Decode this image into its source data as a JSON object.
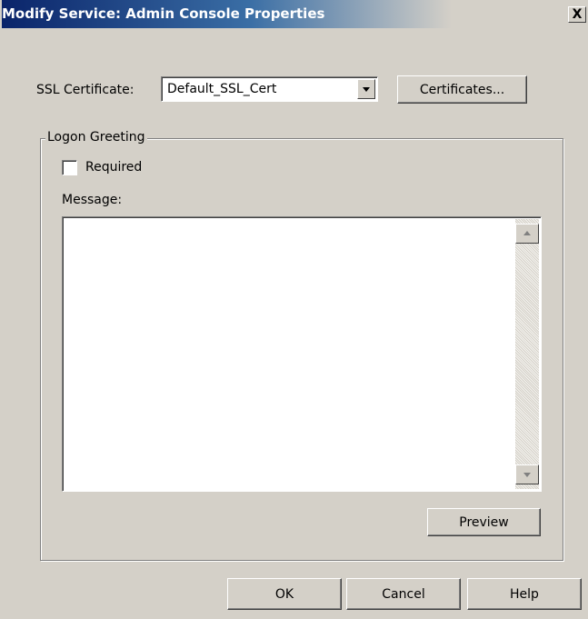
{
  "window": {
    "title": "Modify Service: Admin Console Properties",
    "close_glyph": "X"
  },
  "ssl": {
    "label": "SSL Certificate:",
    "selected_value": "Default_SSL_Cert",
    "certificates_button": "Certificates..."
  },
  "logon_greeting": {
    "group_label": "Logon Greeting",
    "required_label": "Required",
    "required_checked": false,
    "message_label": "Message:",
    "message_value": "",
    "preview_button": "Preview"
  },
  "footer": {
    "ok_button": "OK",
    "cancel_button": "Cancel",
    "help_button": "Help"
  },
  "colors": {
    "title_gradient_start": "#0a246a",
    "title_gradient_end": "#3a6ea5",
    "dialog_background": "#d4d0c8"
  }
}
